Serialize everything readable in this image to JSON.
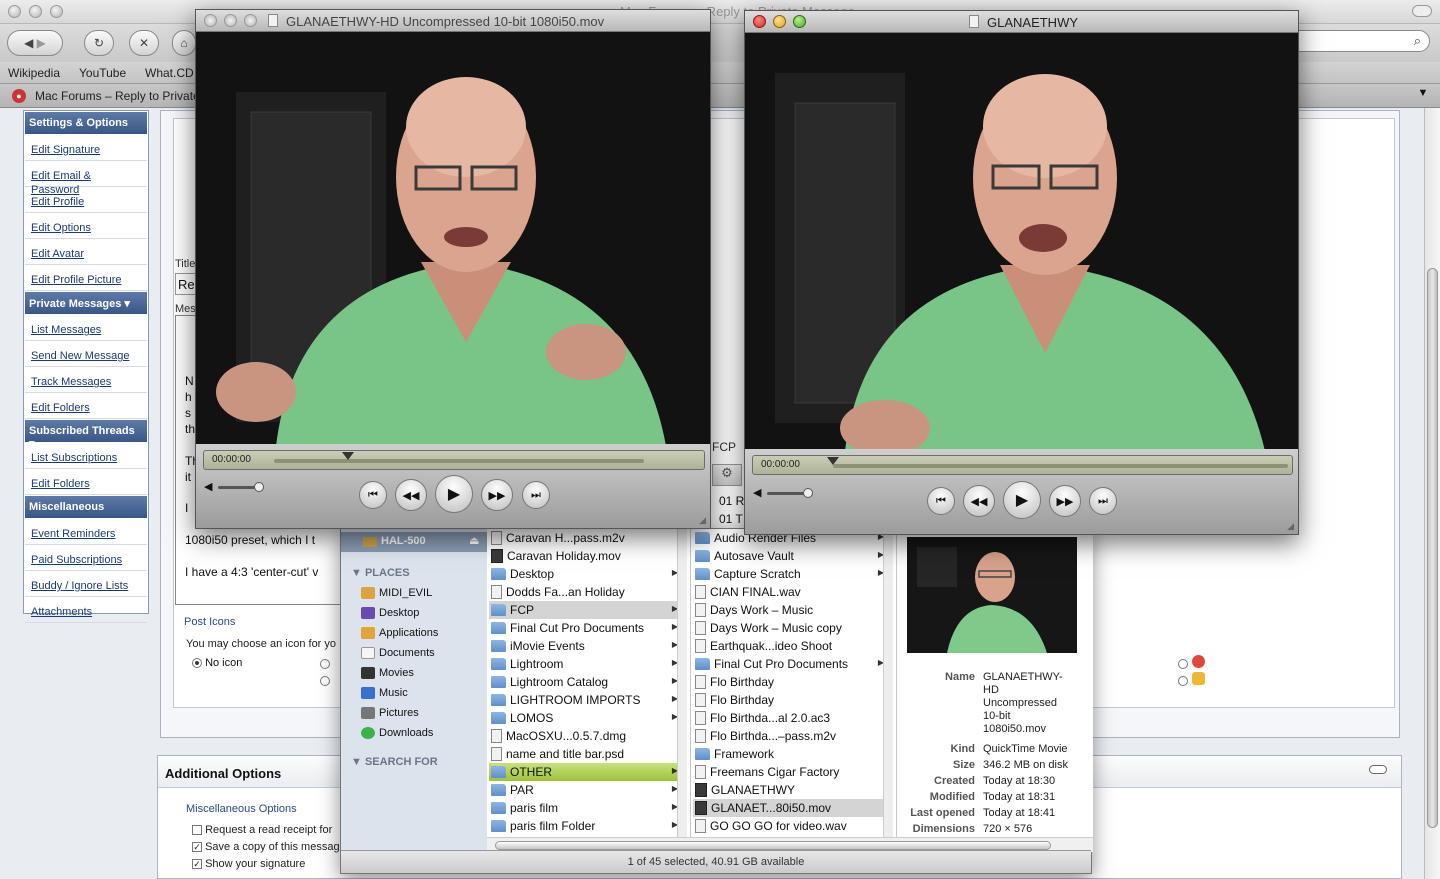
{
  "browser": {
    "window_title": "Mac Forums – Reply to Private Message",
    "bookmarks": [
      "Wikipedia",
      "YouTube",
      "What.CD"
    ],
    "tab_title": "Mac Forums – Reply to Private Message"
  },
  "sidebar": {
    "sections": [
      {
        "head": "Settings & Options",
        "items": [
          "Edit Signature",
          "Edit Email & Password",
          "Edit Profile",
          "Edit Options",
          "Edit Avatar",
          "Edit Profile Picture"
        ]
      },
      {
        "head": "Private Messages",
        "items": [
          "List Messages",
          "Send New Message",
          "Track Messages",
          "Edit Folders"
        ]
      },
      {
        "head": "Subscribed Threads",
        "items": [
          "List Subscriptions",
          "Edit Folders"
        ]
      },
      {
        "head": "Miscellaneous",
        "items": [
          "Event Reminders",
          "Paid Subscriptions",
          "Buddy / Ignore Lists",
          "Attachments"
        ]
      }
    ]
  },
  "form": {
    "title_label": "Title",
    "title_value": "Re",
    "message_label": "Mes",
    "message_lines": [
      "N",
      "h",
      "s",
      "th",
      "Th",
      "it",
      "I",
      "1080i50 preset, which I t",
      "I have a 4:3 'center-cut' v"
    ],
    "post_icons_label": "Post Icons",
    "post_icons_text": "You may choose an icon for yo",
    "no_icon_label": "No icon"
  },
  "additional_options": {
    "head": "Additional Options",
    "misc_label": "Miscellaneous Options",
    "options": [
      {
        "label": "Request a read receipt for",
        "checked": false
      },
      {
        "label": "Save a copy of this messag",
        "checked": true
      },
      {
        "label": "Show your signature",
        "checked": true
      }
    ]
  },
  "qt_left": {
    "title": "GLANAETHWY-HD Uncompressed 10-bit 1080i50.mov",
    "timecode": "00:00:00",
    "playhead_fraction": 0.2
  },
  "qt_right": {
    "title": "GLANAETHWY",
    "timecode": "00:00:00",
    "playhead_fraction": 0.0
  },
  "finder": {
    "fcp_fragment": "FCP",
    "device": "HAL-500",
    "places_head": "PLACES",
    "places": [
      "MIDI_EVIL",
      "Desktop",
      "Applications",
      "Documents",
      "Movies",
      "Music",
      "Pictures",
      "Downloads"
    ],
    "search_head": "SEARCH FOR",
    "col1": [
      {
        "name": "Caravan H...pass.m2v",
        "kind": "file",
        "arrow": false
      },
      {
        "name": "Caravan Holiday.mov",
        "kind": "mov",
        "arrow": false
      },
      {
        "name": "Desktop",
        "kind": "folder",
        "arrow": true
      },
      {
        "name": "Dodds Fa...an Holiday",
        "kind": "file",
        "arrow": false
      },
      {
        "name": "FCP",
        "kind": "folder",
        "arrow": true,
        "sel": "gray"
      },
      {
        "name": "Final Cut Pro Documents",
        "kind": "folder",
        "arrow": true
      },
      {
        "name": "iMovie Events",
        "kind": "folder",
        "arrow": true
      },
      {
        "name": "Lightroom",
        "kind": "folder",
        "arrow": true
      },
      {
        "name": "Lightroom Catalog",
        "kind": "folder",
        "arrow": true
      },
      {
        "name": "LIGHTROOM IMPORTS",
        "kind": "folder",
        "arrow": true
      },
      {
        "name": "LOMOS",
        "kind": "folder",
        "arrow": true
      },
      {
        "name": "MacOSXU...0.5.7.dmg",
        "kind": "file",
        "arrow": false
      },
      {
        "name": "name and title bar.psd",
        "kind": "file",
        "arrow": false
      },
      {
        "name": "OTHER",
        "kind": "folder",
        "arrow": true,
        "sel": "green"
      },
      {
        "name": "PAR",
        "kind": "folder",
        "arrow": true
      },
      {
        "name": "paris film",
        "kind": "folder",
        "arrow": true
      },
      {
        "name": "paris film Folder",
        "kind": "folder",
        "arrow": true
      }
    ],
    "col2_partial": [
      "01 R",
      "01 T"
    ],
    "col2": [
      {
        "name": "Audio Render Files",
        "kind": "folder",
        "arrow": true
      },
      {
        "name": "Autosave Vault",
        "kind": "folder",
        "arrow": true
      },
      {
        "name": "Capture Scratch",
        "kind": "folder",
        "arrow": true
      },
      {
        "name": "CIAN FINAL.wav",
        "kind": "file",
        "arrow": false
      },
      {
        "name": "Days Work – Music",
        "kind": "file",
        "arrow": false
      },
      {
        "name": "Days Work – Music copy",
        "kind": "file",
        "arrow": false
      },
      {
        "name": "Earthquak...ideo Shoot",
        "kind": "file",
        "arrow": false
      },
      {
        "name": "Final Cut Pro Documents",
        "kind": "folder",
        "arrow": true
      },
      {
        "name": "Flo Birthday",
        "kind": "file",
        "arrow": false
      },
      {
        "name": "Flo Birthday",
        "kind": "file",
        "arrow": false
      },
      {
        "name": "Flo Birthda...al 2.0.ac3",
        "kind": "file",
        "arrow": false
      },
      {
        "name": "Flo Birthda...–pass.m2v",
        "kind": "file",
        "arrow": false
      },
      {
        "name": "Framework",
        "kind": "folder",
        "arrow": false
      },
      {
        "name": "Freemans Cigar Factory",
        "kind": "file",
        "arrow": false
      },
      {
        "name": "GLANAETHWY",
        "kind": "mov",
        "arrow": false
      },
      {
        "name": "GLANAET...80i50.mov",
        "kind": "mov",
        "arrow": false,
        "sel": "gray"
      },
      {
        "name": "GO GO GO for video.wav",
        "kind": "file",
        "arrow": false
      }
    ],
    "meta": [
      {
        "k": "Name",
        "v": [
          "GLANAETHWY-",
          "HD",
          "Uncompressed",
          "10-bit",
          "1080i50.mov"
        ]
      },
      {
        "k": "Kind",
        "v": [
          "QuickTime Movie"
        ]
      },
      {
        "k": "Size",
        "v": [
          "346.2 MB on disk"
        ]
      },
      {
        "k": "Created",
        "v": [
          "Today at 18:30"
        ]
      },
      {
        "k": "Modified",
        "v": [
          "Today at 18:31"
        ]
      },
      {
        "k": "Last opened",
        "v": [
          "Today at 18:41"
        ]
      },
      {
        "k": "Dimensions",
        "v": [
          "720 × 576"
        ]
      }
    ],
    "status": "1 of 45 selected, 40.91 GB available"
  }
}
